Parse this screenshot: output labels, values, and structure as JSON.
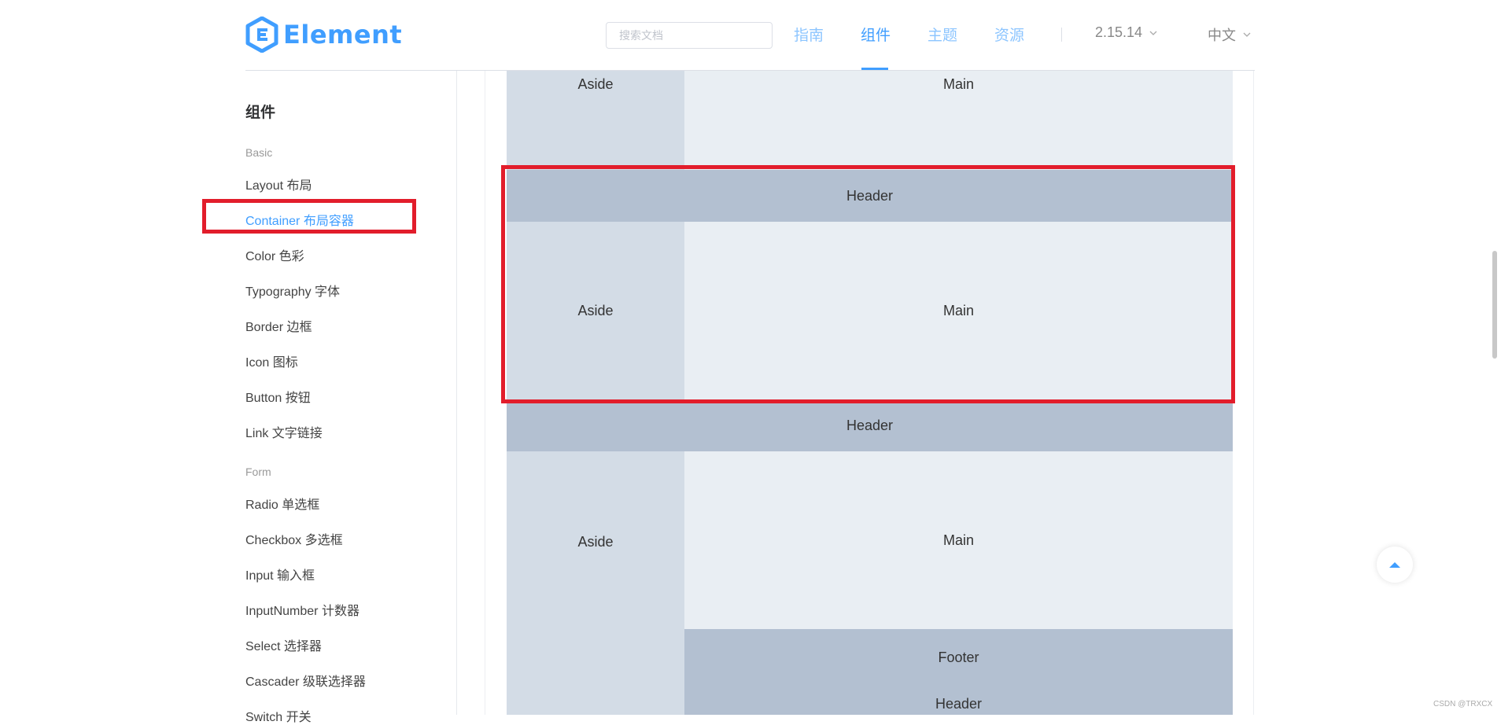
{
  "header": {
    "logo_text": "Element",
    "search_placeholder": "搜索文档",
    "nav": [
      "指南",
      "组件",
      "主题",
      "资源"
    ],
    "version": "2.15.14",
    "language": "中文"
  },
  "sidebar": {
    "title": "组件",
    "groups": [
      {
        "label": "Basic",
        "items": [
          "Layout 布局",
          "Container 布局容器",
          "Color 色彩",
          "Typography 字体",
          "Border 边框",
          "Icon 图标",
          "Button 按钮",
          "Link 文字链接"
        ]
      },
      {
        "label": "Form",
        "items": [
          "Radio 单选框",
          "Checkbox 多选框",
          "Input 输入框",
          "InputNumber 计数器",
          "Select 选择器",
          "Cascader 级联选择器",
          "Switch 开关"
        ]
      }
    ],
    "active_item": "Container 布局容器"
  },
  "demo": {
    "aside": "Aside",
    "main": "Main",
    "header": "Header",
    "footer": "Footer"
  },
  "watermark": "CSDN @TRXCX",
  "colors": {
    "accent": "#409eff",
    "highlight": "#e21d2b",
    "aside_bg": "#d3dce6",
    "main_bg": "#e9eef3",
    "header_bg": "#b3c0d1"
  }
}
